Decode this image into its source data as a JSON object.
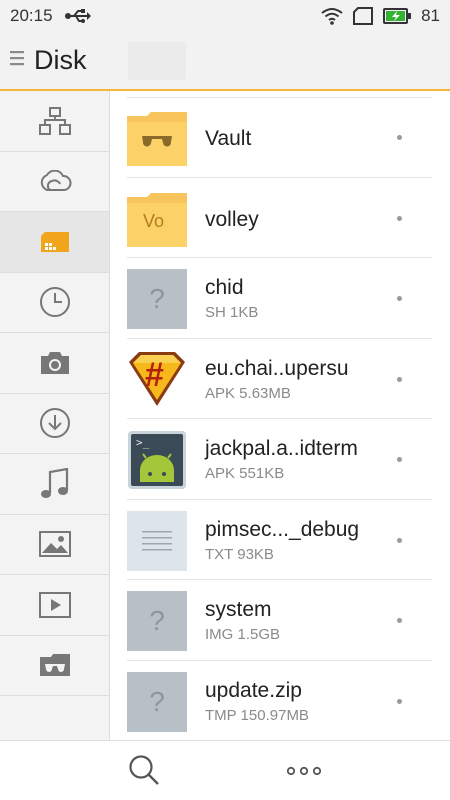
{
  "status_bar": {
    "time": "20:15",
    "battery_level": "81",
    "icons": [
      "usb-icon",
      "wifi-icon",
      "sim-icon",
      "battery-charging-icon"
    ]
  },
  "header": {
    "title": "Disk",
    "menu_icon": "hamburger-menu-icon"
  },
  "sidebar": {
    "items": [
      {
        "icon": "network-icon",
        "active": false
      },
      {
        "icon": "cloud-icon",
        "active": false
      },
      {
        "icon": "sd-card-icon",
        "active": true
      },
      {
        "icon": "clock-icon",
        "active": false
      },
      {
        "icon": "camera-icon",
        "active": false
      },
      {
        "icon": "download-icon",
        "active": false
      },
      {
        "icon": "music-note-icon",
        "active": false
      },
      {
        "icon": "image-icon",
        "active": false
      },
      {
        "icon": "video-icon",
        "active": false
      },
      {
        "icon": "vault-icon",
        "active": false
      }
    ]
  },
  "files": [
    {
      "name": "Vault",
      "meta": "",
      "icon": "vault-folder-icon"
    },
    {
      "name": "volley",
      "meta": "",
      "icon": "folder-icon",
      "badge": "Vo"
    },
    {
      "name": "chid",
      "meta": "SH 1KB",
      "icon": "unknown-file-icon",
      "glyph": "?"
    },
    {
      "name": "eu.chai..upersu",
      "meta": "APK 5.63MB",
      "icon": "supersu-app-icon",
      "glyph": "#"
    },
    {
      "name": "jackpal.a..idterm",
      "meta": "APK 551KB",
      "icon": "terminal-app-icon",
      "glyph": ">_"
    },
    {
      "name": "pimsec..._debug",
      "meta": "TXT 93KB",
      "icon": "text-file-icon"
    },
    {
      "name": "system",
      "meta": "IMG 1.5GB",
      "icon": "unknown-file-icon",
      "glyph": "?"
    },
    {
      "name": "update.zip",
      "meta": "TMP 150.97MB",
      "icon": "unknown-file-icon",
      "glyph": "?"
    }
  ],
  "bottom_bar": {
    "search_icon": "search-icon",
    "more_icon": "more-icon"
  },
  "colors": {
    "accent": "#f3b73a",
    "folder": "#fbd168",
    "unknown_tile": "#b8c0c7",
    "battery_green": "#34b233"
  }
}
